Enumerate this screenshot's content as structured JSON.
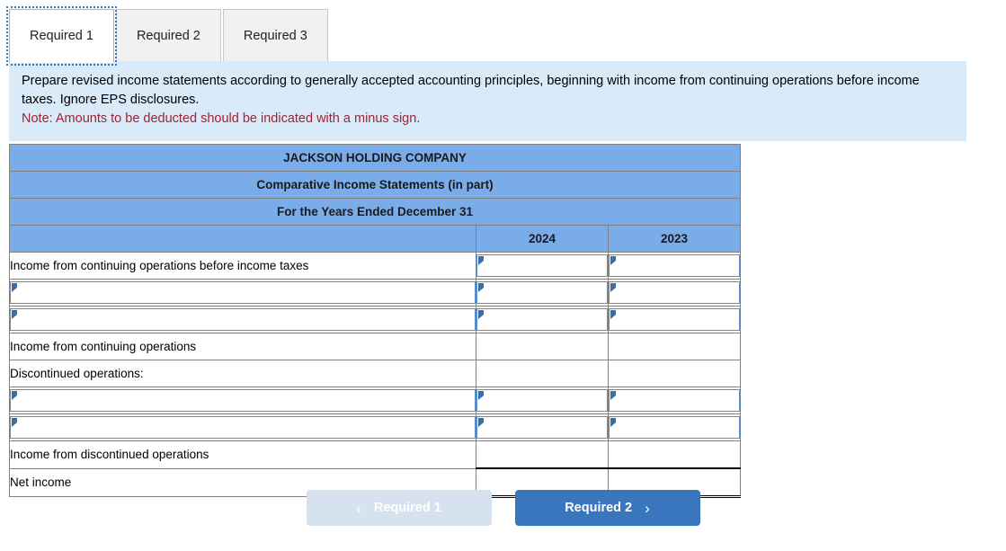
{
  "tabs": [
    {
      "label": "Required 1",
      "active": true
    },
    {
      "label": "Required 2",
      "active": false
    },
    {
      "label": "Required 3",
      "active": false
    }
  ],
  "instructions": {
    "body": "Prepare revised income statements according to generally accepted accounting principles, beginning with income from continuing operations before income taxes. Ignore EPS disclosures.",
    "note": "Note: Amounts to be deducted should be indicated with a minus sign."
  },
  "statement": {
    "title_lines": [
      "JACKSON HOLDING COMPANY",
      "Comparative Income Statements (in part)",
      "For the Years Ended December 31"
    ],
    "year_columns": [
      "2024",
      "2023"
    ],
    "rows": [
      {
        "label": "Income from continuing operations before income taxes",
        "label_input": false,
        "value_input": true
      },
      {
        "label": "",
        "label_input": true,
        "value_input": true
      },
      {
        "label": "",
        "label_input": true,
        "value_input": true
      },
      {
        "label": "Income from continuing operations",
        "label_input": false,
        "value_input": false
      },
      {
        "label": "Discontinued operations:",
        "label_input": false,
        "value_input": false
      },
      {
        "label": "",
        "label_input": true,
        "value_input": true
      },
      {
        "label": "",
        "label_input": true,
        "value_input": true
      },
      {
        "label": "Income from discontinued operations",
        "label_input": false,
        "value_input": false
      },
      {
        "label": "Net income",
        "label_input": false,
        "value_input": false
      }
    ]
  },
  "nav": {
    "prev_label": "Required 1",
    "prev_icon": "chevron-left-icon",
    "next_label": "Required 2",
    "next_icon": "chevron-right-icon"
  },
  "colors": {
    "header_blue": "#7bacea",
    "panel_blue": "#d9ebf9",
    "button_blue": "#3a76bd",
    "button_disabled": "#d6e2f0",
    "note_red": "#a42130",
    "input_border": "#5b8fc9"
  }
}
